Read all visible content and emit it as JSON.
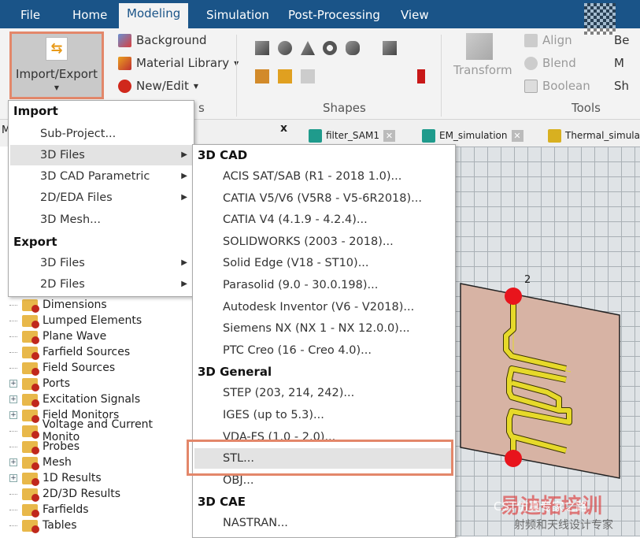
{
  "ribbon_tabs": [
    "File",
    "Home",
    "Modeling",
    "Simulation",
    "Post-Processing",
    "View"
  ],
  "active_tab": "Modeling",
  "ribbon": {
    "import_export": "Import/Export",
    "background": "Background",
    "material_library": "Material Library",
    "new_edit": "New/Edit",
    "group_partial": "s",
    "shapes_label": "Shapes",
    "transform": "Transform",
    "align": "Align",
    "blend": "Blend",
    "boolean": "Boolean",
    "tools_label": "Tools",
    "cut_items": [
      "Be",
      "M",
      "Sh"
    ]
  },
  "panel": {
    "title_partial": "M",
    "close": "x"
  },
  "doc_tabs": [
    "filter_SAM1",
    "EM_simulation",
    "Thermal_simulati"
  ],
  "import_menu": {
    "import_header": "Import",
    "import_items": [
      {
        "label": "Sub-Project..."
      },
      {
        "label": "3D Files",
        "submenu": true
      },
      {
        "label": "3D CAD Parametric",
        "submenu": true
      },
      {
        "label": "2D/EDA Files",
        "submenu": true
      },
      {
        "label": "3D Mesh..."
      }
    ],
    "export_header": "Export",
    "export_items": [
      {
        "label": "3D Files",
        "submenu": true
      },
      {
        "label": "2D Files",
        "submenu": true
      }
    ]
  },
  "submenu": {
    "cad_header": "3D CAD",
    "cad_items": [
      "ACIS SAT/SAB (R1 - 2018 1.0)...",
      "CATIA V5/V6 (V5R8 - V5-6R2018)...",
      "CATIA V4 (4.1.9 - 4.2.4)...",
      "SOLIDWORKS (2003 - 2018)...",
      "Solid Edge (V18 - ST10)...",
      "Parasolid (9.0 - 30.0.198)...",
      "Autodesk Inventor (V6 - V2018)...",
      "Siemens NX (NX 1 - NX 12.0.0)...",
      "PTC Creo (16 - Creo 4.0)..."
    ],
    "general_header": "3D General",
    "general_items": [
      "STEP (203, 214, 242)...",
      "IGES (up to 5.3)...",
      "VDA-FS (1.0 - 2.0)...",
      "STL...",
      "OBJ..."
    ],
    "cae_header": "3D CAE",
    "cae_items": [
      "NASTRAN..."
    ]
  },
  "tree": [
    {
      "label": "Dimensions",
      "expand": false
    },
    {
      "label": "Lumped Elements",
      "expand": false
    },
    {
      "label": "Plane Wave",
      "expand": false
    },
    {
      "label": "Farfield Sources",
      "expand": false
    },
    {
      "label": "Field Sources",
      "expand": false
    },
    {
      "label": "Ports",
      "expand": true
    },
    {
      "label": "Excitation Signals",
      "expand": true
    },
    {
      "label": "Field Monitors",
      "expand": true
    },
    {
      "label": "Voltage and Current Monito",
      "expand": false
    },
    {
      "label": "Probes",
      "expand": false
    },
    {
      "label": "Mesh",
      "expand": true
    },
    {
      "label": "1D Results",
      "expand": true
    },
    {
      "label": "2D/3D Results",
      "expand": false
    },
    {
      "label": "Farfields",
      "expand": false
    },
    {
      "label": "Tables",
      "expand": false
    }
  ],
  "viewport": {
    "port_label": "2"
  },
  "watermark": {
    "line1": "CST仿真专家之路",
    "line2": "易迪拓培训",
    "line3": "射频和天线设计专家"
  },
  "colors": {
    "tabbar": "#1a5488",
    "highlight": "#e3876a",
    "substrate": "#d7b3a4",
    "trace": "#e6d92a",
    "port": "#e8141c"
  }
}
